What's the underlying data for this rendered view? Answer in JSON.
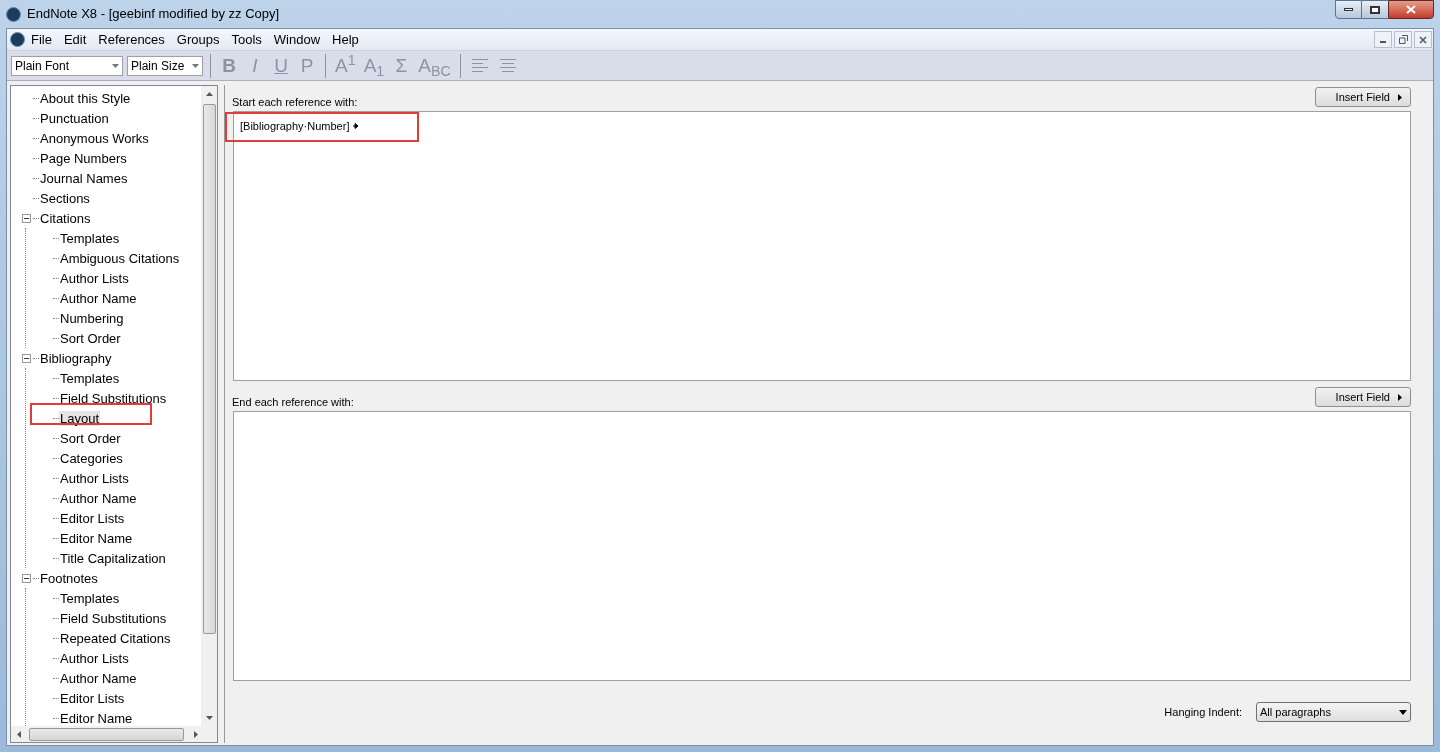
{
  "window": {
    "title": "EndNote X8 - [geebinf modified by zz Copy]"
  },
  "menu": [
    "File",
    "Edit",
    "References",
    "Groups",
    "Tools",
    "Window",
    "Help"
  ],
  "toolbar": {
    "font": "Plain Font",
    "size": "Plain Size",
    "buttons": [
      {
        "kind": "text",
        "label": "B",
        "disabled": true
      },
      {
        "kind": "text",
        "label": "I",
        "disabled": true
      },
      {
        "kind": "text",
        "label": "U",
        "disabled": true
      },
      {
        "kind": "text",
        "label": "P",
        "disabled": true
      },
      {
        "kind": "sep"
      },
      {
        "kind": "text",
        "label": "A$^{1}$",
        "disabled": true
      },
      {
        "kind": "text",
        "label": "A$_{1}$",
        "disabled": true
      },
      {
        "kind": "text",
        "label": "Σ",
        "disabled": true
      },
      {
        "kind": "text",
        "label": "A$_{BC}$",
        "disabled": true
      },
      {
        "kind": "sep"
      },
      {
        "kind": "align-left",
        "disabled": true
      },
      {
        "kind": "align-center",
        "disabled": true
      }
    ]
  },
  "tree": [
    {
      "label": "About this Style",
      "selected": false
    },
    {
      "label": "Punctuation",
      "selected": false
    },
    {
      "label": "Anonymous Works",
      "selected": false
    },
    {
      "label": "Page Numbers",
      "selected": false
    },
    {
      "label": "Journal Names",
      "selected": false
    },
    {
      "label": "Sections",
      "selected": false
    },
    {
      "label": "Citations",
      "selected": false,
      "expanded": true,
      "children": [
        {
          "label": "Templates",
          "selected": false
        },
        {
          "label": "Ambiguous Citations",
          "selected": false
        },
        {
          "label": "Author Lists",
          "selected": false
        },
        {
          "label": "Author Name",
          "selected": false
        },
        {
          "label": "Numbering",
          "selected": false
        },
        {
          "label": "Sort Order",
          "selected": false
        }
      ]
    },
    {
      "label": "Bibliography",
      "selected": false,
      "expanded": true,
      "children": [
        {
          "label": "Templates",
          "selected": false
        },
        {
          "label": "Field Substitutions",
          "selected": false
        },
        {
          "label": "Layout",
          "selected": true
        },
        {
          "label": "Sort Order",
          "selected": false
        },
        {
          "label": "Categories",
          "selected": false
        },
        {
          "label": "Author Lists",
          "selected": false
        },
        {
          "label": "Author Name",
          "selected": false
        },
        {
          "label": "Editor Lists",
          "selected": false
        },
        {
          "label": "Editor Name",
          "selected": false
        },
        {
          "label": "Title Capitalization",
          "selected": false
        }
      ]
    },
    {
      "label": "Footnotes",
      "selected": false,
      "expanded": true,
      "children": [
        {
          "label": "Templates",
          "selected": false
        },
        {
          "label": "Field Substitutions",
          "selected": false
        },
        {
          "label": "Repeated Citations",
          "selected": false
        },
        {
          "label": "Author Lists",
          "selected": false
        },
        {
          "label": "Author Name",
          "selected": false
        },
        {
          "label": "Editor Lists",
          "selected": false
        },
        {
          "label": "Editor Name",
          "selected": false
        }
      ]
    }
  ],
  "start_section": {
    "label": "Start each reference with:",
    "button": "Insert Field",
    "value": "[Bibliography·Number]"
  },
  "end_section": {
    "label": "End each reference with:",
    "button": "Insert Field"
  },
  "hanging_indent": {
    "label": "Hanging Indent:",
    "value": "All paragraphs"
  }
}
